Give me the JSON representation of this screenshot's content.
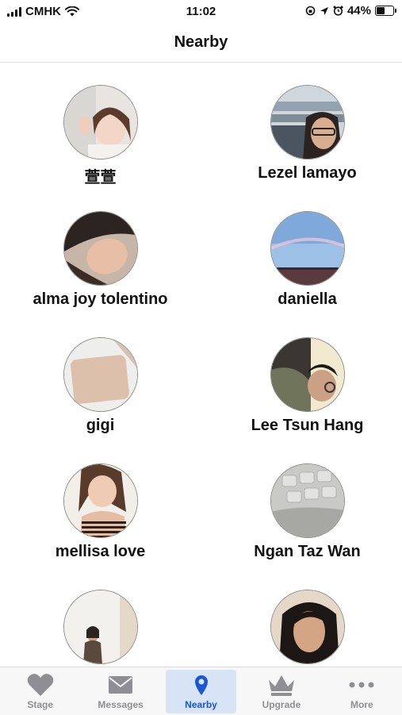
{
  "status_bar": {
    "carrier": "CMHK",
    "time": "11:02",
    "battery_percent": "44%",
    "battery_level": 0.44
  },
  "nav": {
    "title": "Nearby"
  },
  "users": [
    {
      "name": "萱萱"
    },
    {
      "name": "Lezel lamayo"
    },
    {
      "name": "alma joy tolentino"
    },
    {
      "name": "daniella"
    },
    {
      "name": "gigi"
    },
    {
      "name": "Lee Tsun Hang"
    },
    {
      "name": "mellisa love"
    },
    {
      "name": "Ngan Taz Wan"
    },
    {
      "name": ""
    },
    {
      "name": ""
    }
  ],
  "tabs": [
    {
      "label": "Stage",
      "icon": "heart-icon",
      "active": false
    },
    {
      "label": "Messages",
      "icon": "envelope-icon",
      "active": false
    },
    {
      "label": "Nearby",
      "icon": "location-pin-icon",
      "active": true
    },
    {
      "label": "Upgrade",
      "icon": "crown-icon",
      "active": false
    },
    {
      "label": "More",
      "icon": "more-dots-icon",
      "active": false
    }
  ],
  "colors": {
    "accent": "#1a56d6",
    "tab_active_bg": "#d6e4f5",
    "tab_inactive": "#8e8e93"
  }
}
